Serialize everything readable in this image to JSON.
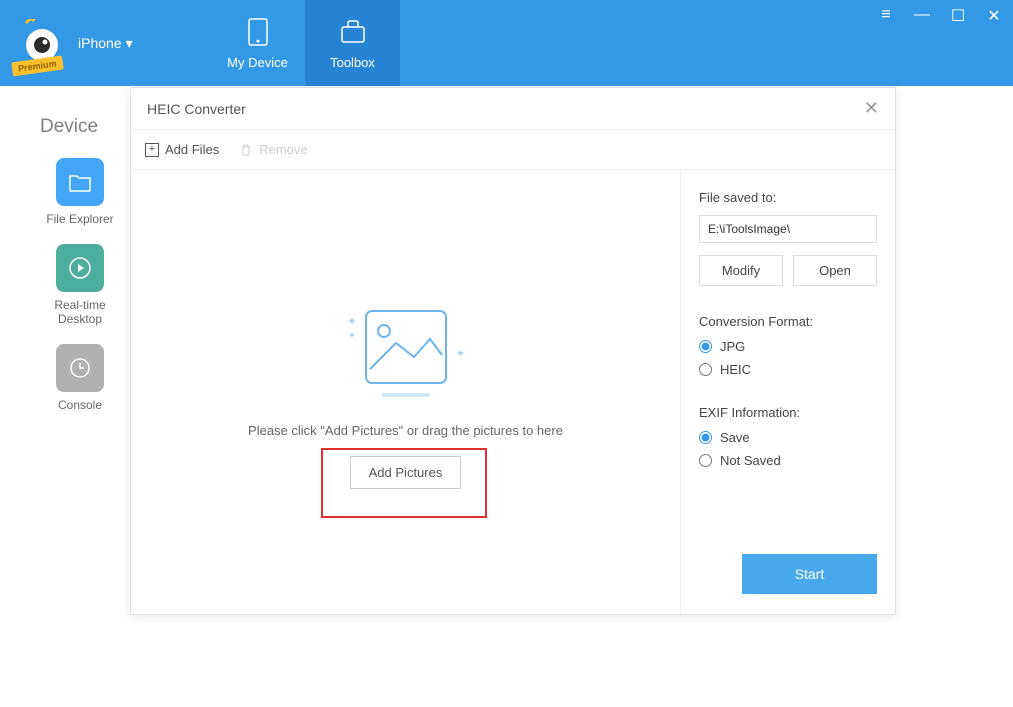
{
  "header": {
    "device_label": "iPhone",
    "premium_badge": "Premium",
    "tabs": [
      {
        "label": "My Device"
      },
      {
        "label": "Toolbox"
      }
    ]
  },
  "background": {
    "title": "Device",
    "sidebar": [
      {
        "label": "File Explorer"
      },
      {
        "label": "Real-time Desktop"
      },
      {
        "label": "Console"
      }
    ]
  },
  "modal": {
    "title": "HEIC Converter",
    "toolbar": {
      "add_files": "Add Files",
      "remove": "Remove"
    },
    "drop": {
      "hint": "Please click \"Add Pictures\" or drag the pictures to here",
      "button": "Add Pictures"
    },
    "panel": {
      "saved_to_label": "File saved to:",
      "saved_to_value": "E:\\iToolsImage\\",
      "modify": "Modify",
      "open": "Open",
      "format_label": "Conversion Format:",
      "format_options": [
        "JPG",
        "HEIC"
      ],
      "format_selected": "JPG",
      "exif_label": "EXIF Information:",
      "exif_options": [
        "Save",
        "Not Saved"
      ],
      "exif_selected": "Save",
      "start": "Start"
    }
  }
}
